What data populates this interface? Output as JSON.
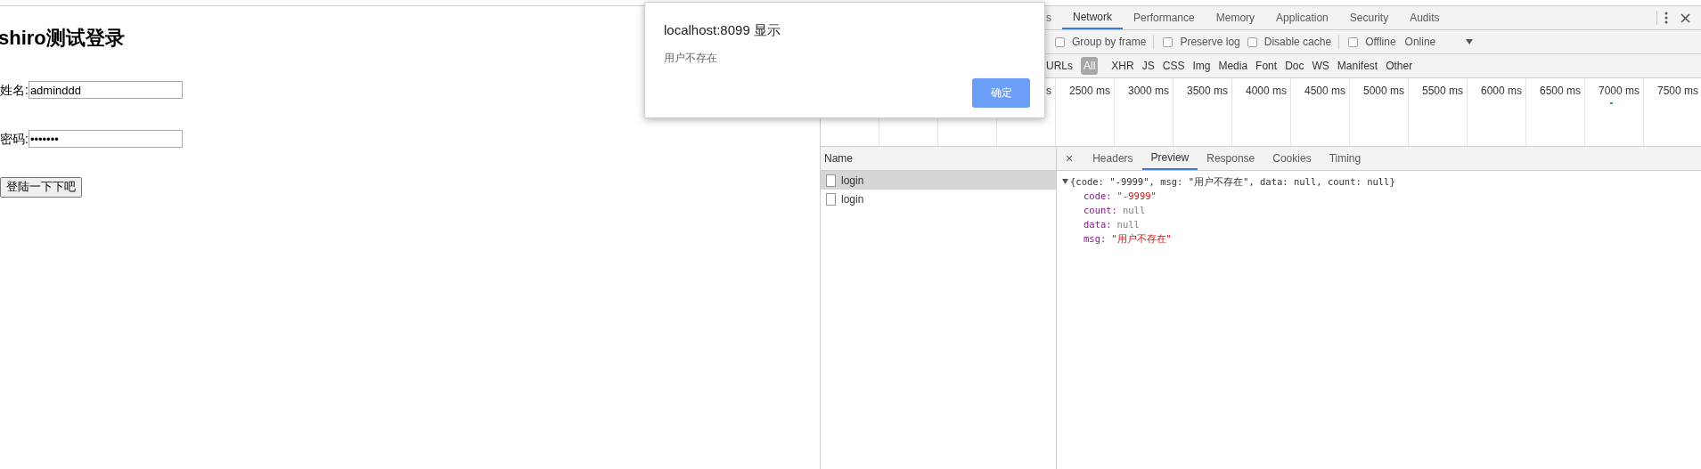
{
  "page": {
    "heading": "shiro测试登录",
    "fields": [
      {
        "label": "姓名:",
        "value": "adminddd"
      },
      {
        "label": "密码:",
        "value": "•••••••"
      }
    ],
    "submit": "登陆一下下吧"
  },
  "dialog": {
    "title": "localhost:8099 显示",
    "message": "用户不存在",
    "button": "确定"
  },
  "devtools": {
    "tabs": [
      {
        "label": "s",
        "selected": false
      },
      {
        "label": "Network",
        "selected": true
      },
      {
        "label": "Performance",
        "selected": false
      },
      {
        "label": "Memory",
        "selected": false
      },
      {
        "label": "Application",
        "selected": false
      },
      {
        "label": "Security",
        "selected": false
      },
      {
        "label": "Audits",
        "selected": false
      }
    ],
    "options": [
      {
        "label": "Group by frame",
        "checked": false
      },
      {
        "label": "Preserve log",
        "checked": false
      },
      {
        "label": "Disable cache",
        "checked": false
      },
      {
        "label": "Offline",
        "checked": false
      }
    ],
    "throttle": "Online",
    "filters": [
      {
        "label": "URLs",
        "selected": false
      },
      {
        "label": "All",
        "selected": true
      },
      {
        "label": "XHR",
        "selected": false
      },
      {
        "label": "JS",
        "selected": false
      },
      {
        "label": "CSS",
        "selected": false
      },
      {
        "label": "Img",
        "selected": false
      },
      {
        "label": "Media",
        "selected": false
      },
      {
        "label": "Font",
        "selected": false
      },
      {
        "label": "Doc",
        "selected": false
      },
      {
        "label": "WS",
        "selected": false
      },
      {
        "label": "Manifest",
        "selected": false
      },
      {
        "label": "Other",
        "selected": false
      }
    ],
    "timeline_ticks": [
      "s",
      "2500 ms",
      "3000 ms",
      "3500 ms",
      "4000 ms",
      "4500 ms",
      "5000 ms",
      "5500 ms",
      "6000 ms",
      "6500 ms",
      "7000 ms",
      "7500 ms"
    ],
    "requests": {
      "header": "Name",
      "rows": [
        {
          "name": "login",
          "selected": true
        },
        {
          "name": "login",
          "selected": false
        }
      ]
    },
    "detail_close": "×",
    "detail_tabs": [
      {
        "label": "Headers",
        "selected": false
      },
      {
        "label": "Preview",
        "selected": true
      },
      {
        "label": "Response",
        "selected": false
      },
      {
        "label": "Cookies",
        "selected": false
      },
      {
        "label": "Timing",
        "selected": false
      }
    ],
    "preview": {
      "summary": "{code: \"-9999\", msg: \"用户不存在\", data: null, count: null}",
      "properties": [
        {
          "key": "code:",
          "value": "\"-9999\"",
          "kind": "string"
        },
        {
          "key": "count:",
          "value": "null",
          "kind": "null"
        },
        {
          "key": "data:",
          "value": "null",
          "kind": "null"
        },
        {
          "key": "msg:",
          "value": "\"用户不存在\"",
          "kind": "string"
        }
      ]
    }
  }
}
